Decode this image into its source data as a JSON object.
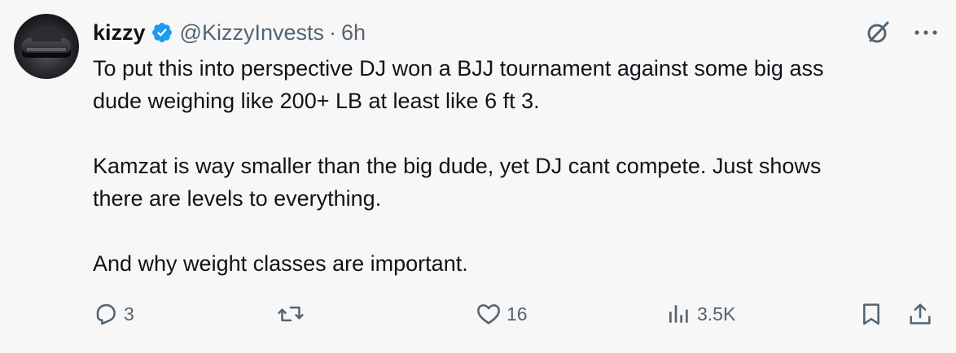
{
  "author": {
    "name": "kizzy",
    "handle": "@KizzyInvests",
    "separator": "·",
    "time": "6h"
  },
  "top_icons": [
    "grok-icon",
    "more-icon"
  ],
  "more_label": "···",
  "text": {
    "p1_line1": "To put this into perspective DJ won a BJJ tournament against some big ass",
    "p1_line2": "dude weighing like 200+ LB at least like 6 ft 3.",
    "p2_line1": "Kamzat is way smaller than the big dude, yet DJ cant compete. Just shows",
    "p2_line2": "there are levels to everything.",
    "p3_line1": "And why weight classes are important."
  },
  "actions": {
    "replies": "3",
    "reposts": "",
    "likes": "16",
    "views": "3.5K"
  },
  "colors": {
    "background": "#f7f7f7",
    "text": "#0f1419",
    "muted": "#536471",
    "verified": "#1d9bf0"
  }
}
